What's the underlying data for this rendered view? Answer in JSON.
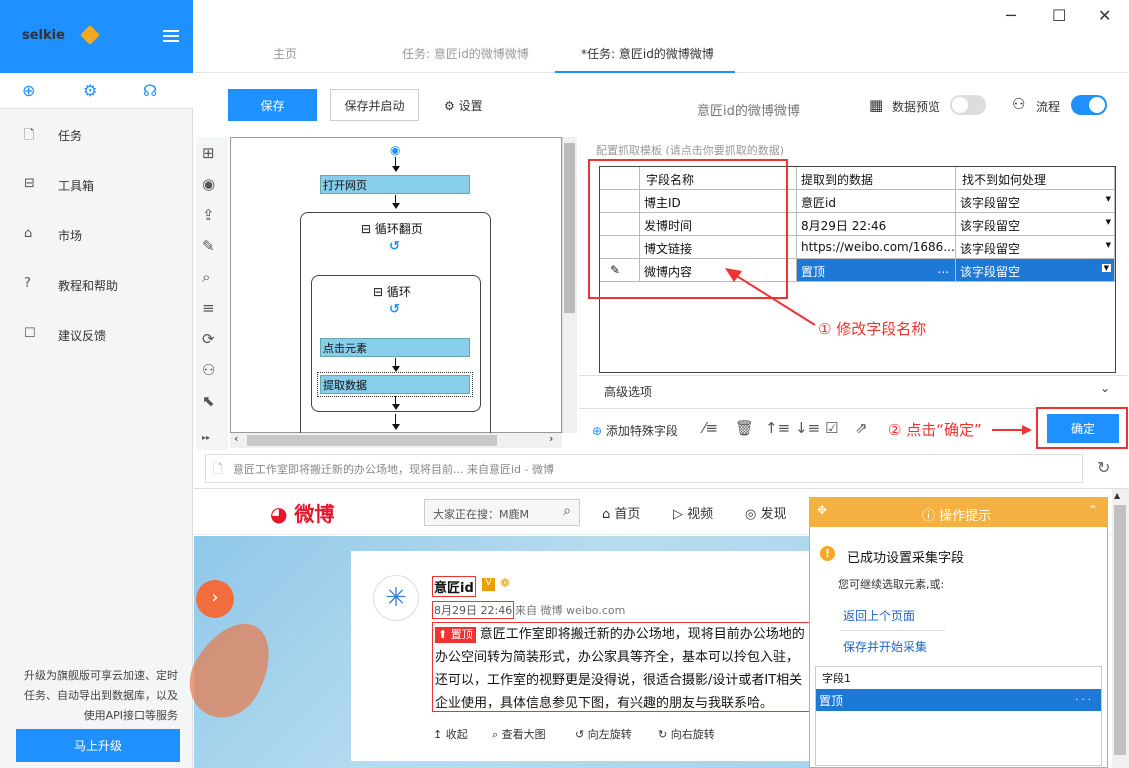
{
  "sidebar": {
    "brand": "selkie",
    "items": [
      {
        "icon": "document-icon",
        "label": "任务"
      },
      {
        "icon": "toolbox-icon",
        "label": "工具箱"
      },
      {
        "icon": "lock-icon",
        "label": "市场"
      },
      {
        "icon": "help-icon",
        "label": "教程和帮助"
      },
      {
        "icon": "feedback-icon",
        "label": "建议反馈"
      }
    ],
    "promo": "升级为旗舰版可享云加速、定时任务、自动导出到数据库，以及使用API接口等服务",
    "upgrade_label": "马上升级"
  },
  "tabs": [
    {
      "label": "主页"
    },
    {
      "label": "任务: 意匠id的微博微博"
    },
    {
      "label": "*任务: 意匠id的微博微博"
    }
  ],
  "toolbar": {
    "save_label": "保存",
    "save_run_label": "保存并启动",
    "settings_label": "设置",
    "task_title": "意匠id的微博微博",
    "preview_label": "数据预览",
    "preview_on": false,
    "flow_label": "流程",
    "flow_on": true
  },
  "flow": {
    "open_page": "打开网页",
    "loop_page": "循环翻页",
    "loop": "循环",
    "click": "点击元素",
    "extract": "提取数据"
  },
  "config": {
    "label": "配置抓取模板 (请点击你要抓取的数据)",
    "columns": [
      "字段名称",
      "提取到的数据",
      "找不到如何处理"
    ],
    "rows": [
      {
        "name": "博主ID",
        "value": "意匠id",
        "handling": "该字段留空"
      },
      {
        "name": "发博时间",
        "value": "8月29日 22:46",
        "handling": "该字段留空"
      },
      {
        "name": "博文链接",
        "value": "https://weibo.com/1686...",
        "handling": "该字段留空"
      },
      {
        "name": "微博内容",
        "value": "置顶",
        "handling": "该字段留空",
        "selected": true
      }
    ],
    "annotation1": "① 修改字段名称",
    "advanced_label": "高级选项",
    "add_field_label": "添加特殊字段",
    "annotation2": "② 点击“确定”",
    "ok_label": "确定"
  },
  "browser": {
    "url_text": "意匠工作室即将搬迁新的办公场地，现将目前... 来自意匠id - 微博"
  },
  "weibo": {
    "logo": "微博",
    "search_text": "大家正在搜：M鹿M",
    "nav": [
      "首页",
      "视频",
      "发现"
    ],
    "user": "意匠id",
    "time": "8月29日 22:46",
    "source": "来自 微博 weibo.com",
    "pin": "置顶",
    "content": "意匠工作室即将搬迁新的办公场地，现将目前办公场地的办公空间转为简装形式，办公家具等齐全，基本可以拎包入驻，还可以，工作室的视野更是没得说，很适合摄影/设计或者IT相关企业使用，具体信息参见下图，有兴趣的朋友与我联系哈。",
    "actions": [
      "收起",
      "查看大图",
      "向左旋转",
      "向右旋转"
    ]
  },
  "tips": {
    "title": "操作提示",
    "message": "已成功设置采集字段",
    "sub": "您可继续选取元素,或:",
    "link1": "返回上个页面",
    "link2": "保存并开始采集",
    "item1": "字段1",
    "item2": "置顶",
    "item2_more": ". . ."
  },
  "colors": {
    "accent": "#1e90ff",
    "annotation": "#e33333",
    "tips": "#f5b042"
  }
}
